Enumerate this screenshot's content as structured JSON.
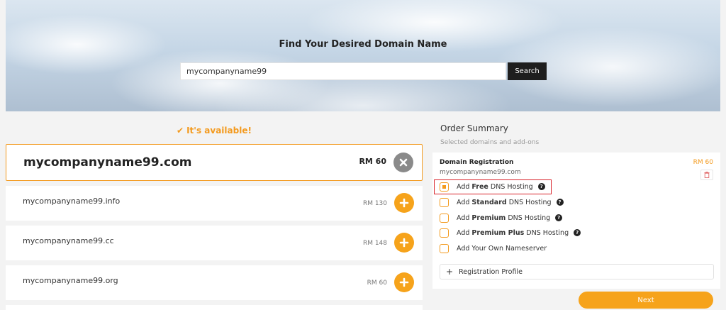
{
  "hero": {
    "title": "Find Your Desired Domain Name",
    "search_value": "mycompanyname99",
    "search_button": "Search"
  },
  "availability": {
    "message": "It's available!",
    "icon": "check-icon",
    "color": "#f39a1e"
  },
  "selected_domain": {
    "name": "mycompanyname99.com",
    "price": "RM 60"
  },
  "suggestions": [
    {
      "name": "mycompanyname99.info",
      "price": "RM 130"
    },
    {
      "name": "mycompanyname99.cc",
      "price": "RM 148"
    },
    {
      "name": "mycompanyname99.org",
      "price": "RM 60"
    }
  ],
  "order_summary": {
    "title": "Order Summary",
    "subtitle": "Selected domains and add-ons",
    "registration": {
      "title": "Domain Registration",
      "domain": "mycompanyname99.com",
      "price": "RM 60"
    },
    "options": [
      {
        "prefix": "Add ",
        "bold": "Free",
        "suffix": " DNS Hosting",
        "checked": true,
        "help": true
      },
      {
        "prefix": "Add ",
        "bold": "Standard",
        "suffix": " DNS Hosting",
        "checked": false,
        "help": true
      },
      {
        "prefix": "Add ",
        "bold": "Premium",
        "suffix": " DNS Hosting",
        "checked": false,
        "help": true
      },
      {
        "prefix": "Add ",
        "bold": "Premium Plus",
        "suffix": " DNS Hosting",
        "checked": false,
        "help": true
      },
      {
        "prefix": "Add Your Own Nameserver",
        "bold": "",
        "suffix": "",
        "checked": false,
        "help": false
      }
    ],
    "profile_label": "Registration Profile",
    "next_button": "Next"
  },
  "colors": {
    "accent": "#f6a31b",
    "highlight": "#d8232a",
    "dark_button": "#1e1e1e"
  }
}
